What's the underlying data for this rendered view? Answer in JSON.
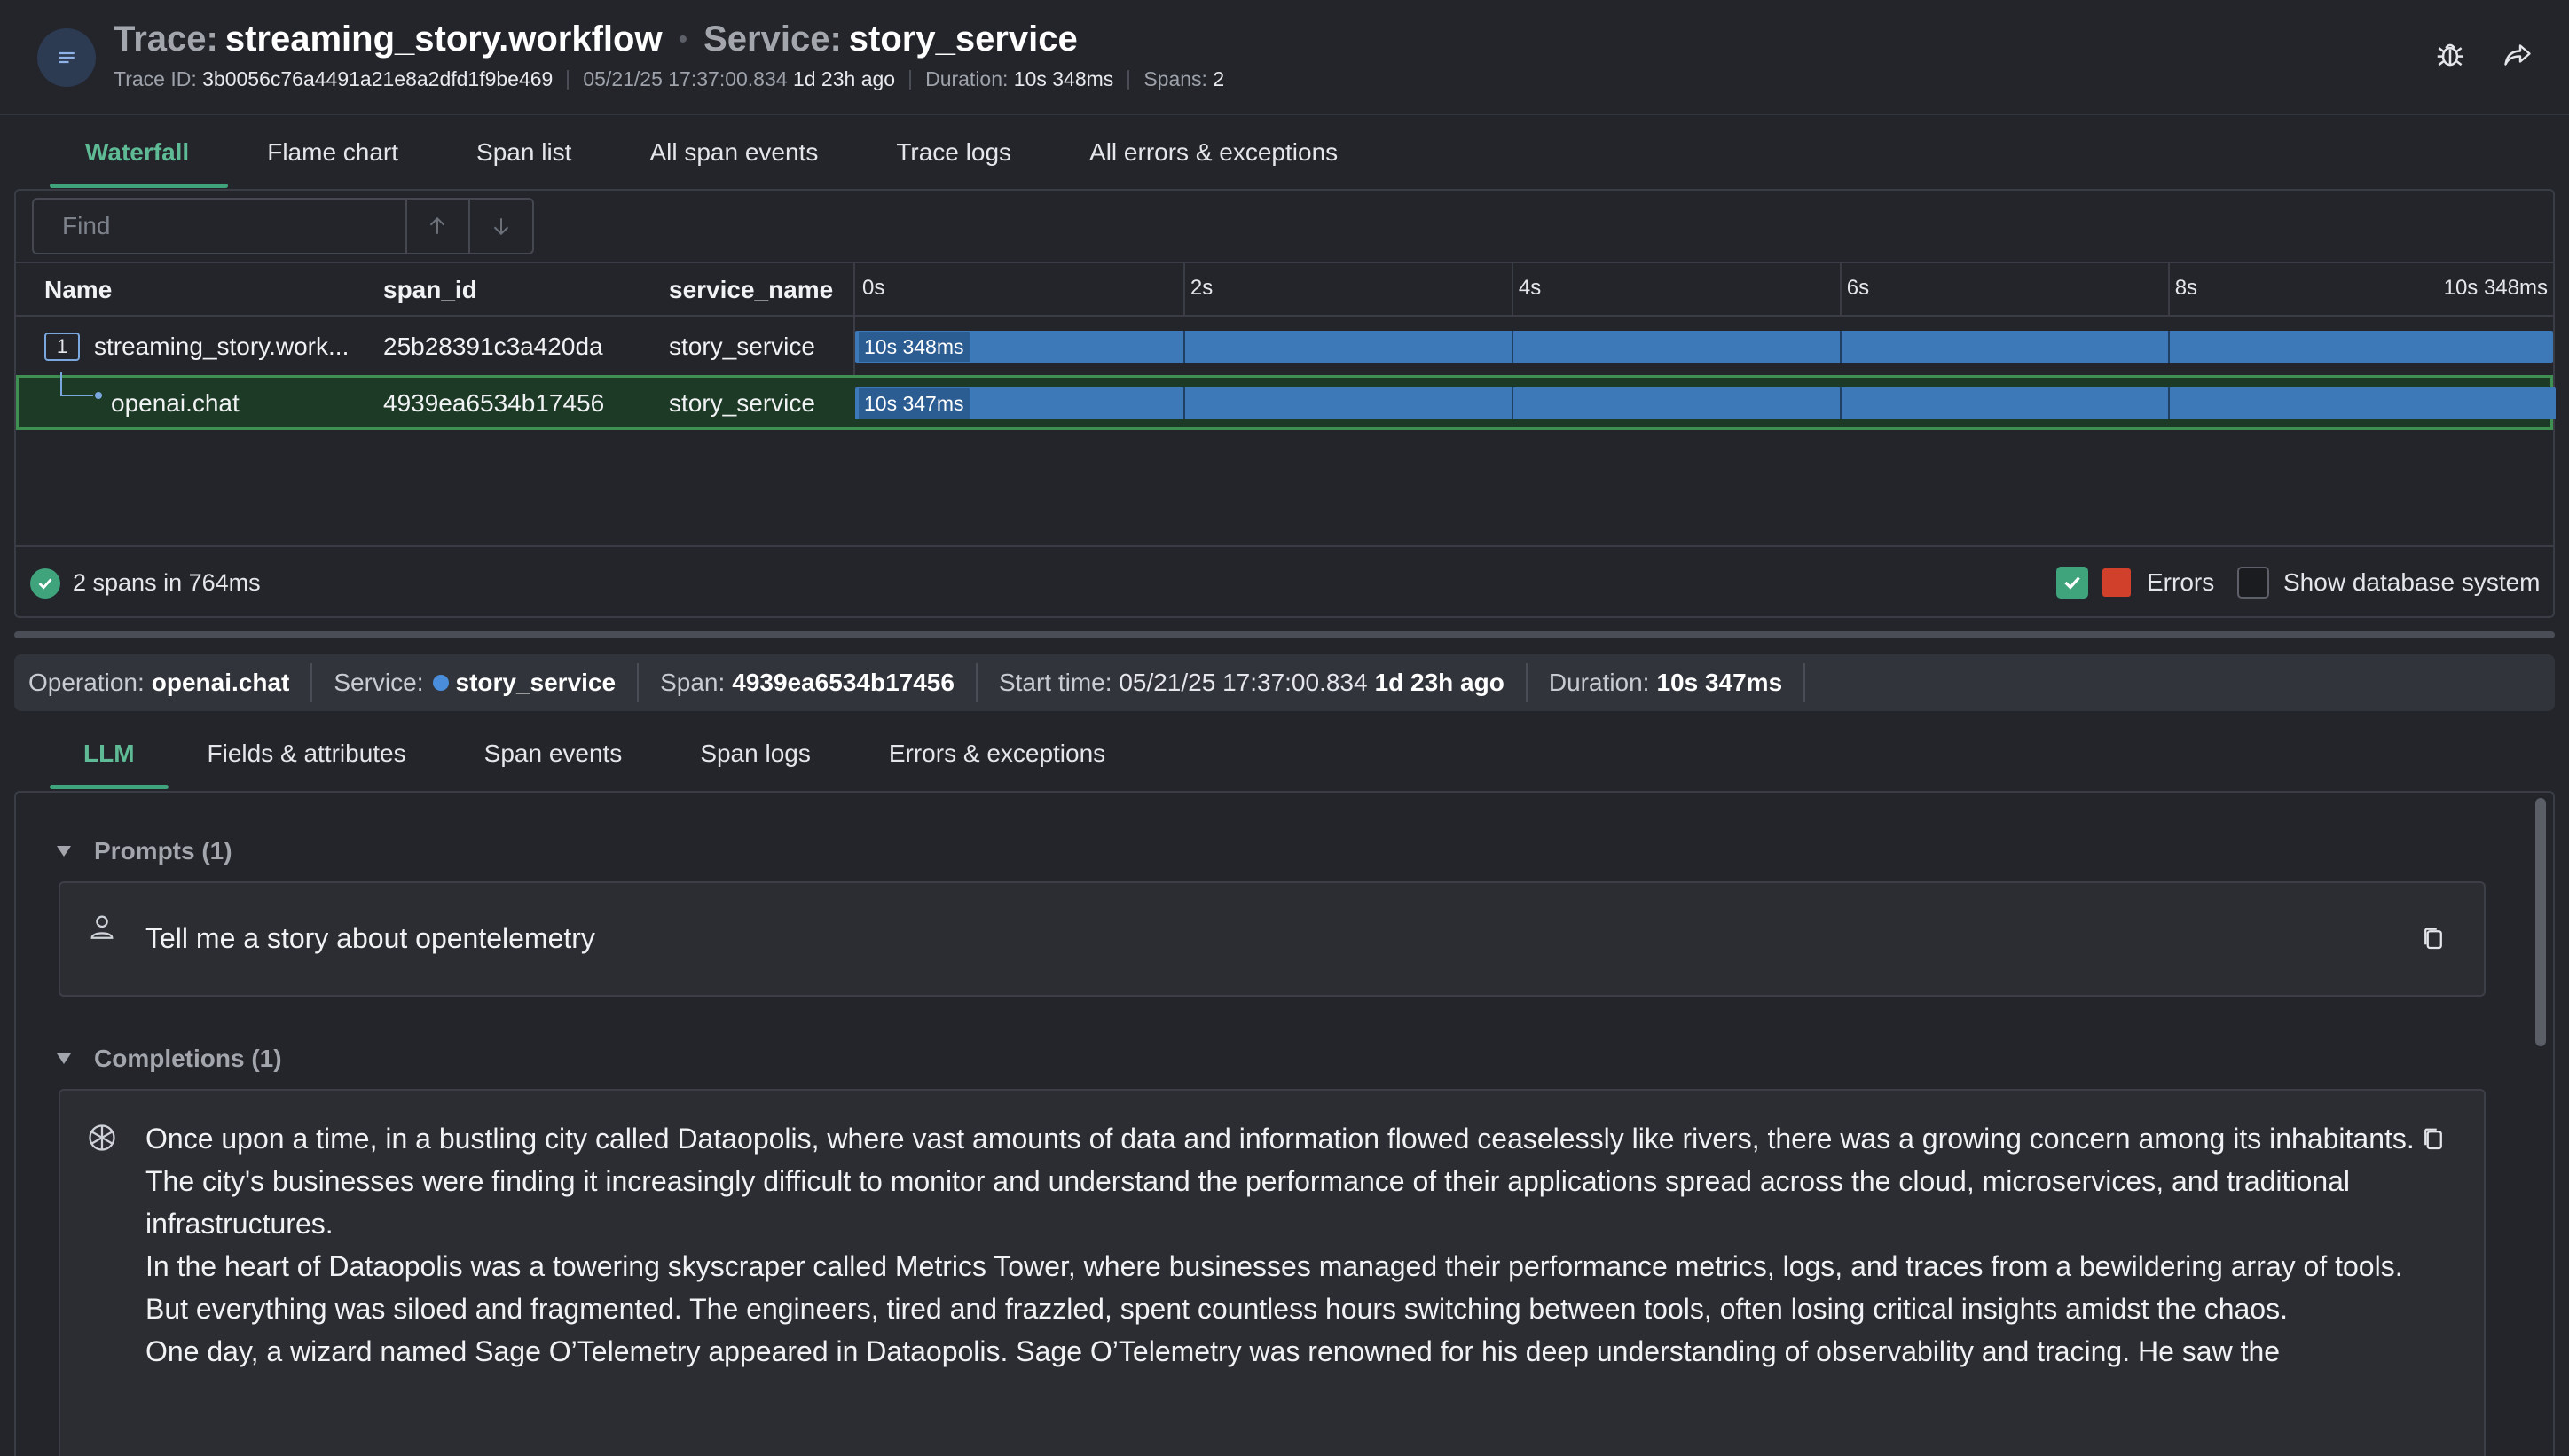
{
  "header": {
    "trace_label": "Trace:",
    "trace_name": "streaming_story.workflow",
    "service_label": "Service:",
    "service_name": "story_service",
    "trace_id_label": "Trace ID:",
    "trace_id": "3b0056c76a4491a21e8a2dfd1f9be469",
    "timestamp": "05/21/25 17:37:00.834",
    "age": "1d 23h ago",
    "duration_label": "Duration:",
    "duration": "10s 348ms",
    "spans_label": "Spans:",
    "spans": "2",
    "icons": [
      "menu-icon",
      "bug-icon",
      "share-icon"
    ]
  },
  "main_tabs": [
    "Waterfall",
    "Flame chart",
    "Span list",
    "All span events",
    "Trace logs",
    "All errors & exceptions"
  ],
  "main_tabs_active": "Waterfall",
  "find": {
    "placeholder": "Find"
  },
  "columns": {
    "name": "Name",
    "span_id": "span_id",
    "service_name": "service_name"
  },
  "timeline_ticks": [
    "0s",
    "2s",
    "4s",
    "6s",
    "8s",
    "10s 348ms"
  ],
  "rows": [
    {
      "depth_badge": "1",
      "name": "streaming_story.work...",
      "span_id": "25b28391c3a420da",
      "service": "story_service",
      "duration": "10s 348ms",
      "start_fraction": 0,
      "width_fraction": 1.0,
      "selected": false
    },
    {
      "name": "openai.chat",
      "span_id": "4939ea6534b17456",
      "service": "story_service",
      "duration": "10s 347ms",
      "start_fraction": 0,
      "width_fraction": 1.0,
      "selected": true
    }
  ],
  "footer": {
    "summary": "2 spans in 764ms",
    "errors_label": "Errors",
    "errors_checked": true,
    "show_db_label": "Show database system",
    "show_db_checked": false
  },
  "span_info": {
    "operation_label": "Operation:",
    "operation": "openai.chat",
    "service_label": "Service:",
    "service": "story_service",
    "span_label": "Span:",
    "span": "4939ea6534b17456",
    "start_label": "Start time:",
    "start": "05/21/25 17:37:00.834",
    "start_age": "1d 23h ago",
    "duration_label": "Duration:",
    "duration": "10s 347ms"
  },
  "detail_tabs": [
    "LLM",
    "Fields & attributes",
    "Span events",
    "Span logs",
    "Errors & exceptions"
  ],
  "detail_tabs_active": "LLM",
  "llm": {
    "prompts_title": "Prompts (1)",
    "prompt_text": "Tell me a story about opentelemetry",
    "completions_title": "Completions (1)",
    "completion_paragraphs": [
      "Once upon a time, in a bustling city called Dataopolis, where vast amounts of data and information flowed ceaselessly like rivers, there was a growing concern among its inhabitants. The city's businesses were finding it increasingly difficult to monitor and understand the performance of their applications spread across the cloud, microservices, and traditional infrastructures.",
      "In the heart of Dataopolis was a towering skyscraper called Metrics Tower, where businesses managed their performance metrics, logs, and traces from a bewildering array of tools. But everything was siloed and fragmented. The engineers, tired and frazzled, spent countless hours switching between tools, often losing critical insights amidst the chaos.",
      "One day, a wizard named Sage O’Telemetry appeared in Dataopolis. Sage O’Telemetry was renowned for his deep understanding of observability and tracing. He saw the"
    ]
  },
  "colors": {
    "accent": "#3fa37c",
    "bar": "#3d78b9",
    "selected_row": "#1d3a26",
    "error": "#d0402b",
    "service_dot": "#4a8ddb"
  }
}
